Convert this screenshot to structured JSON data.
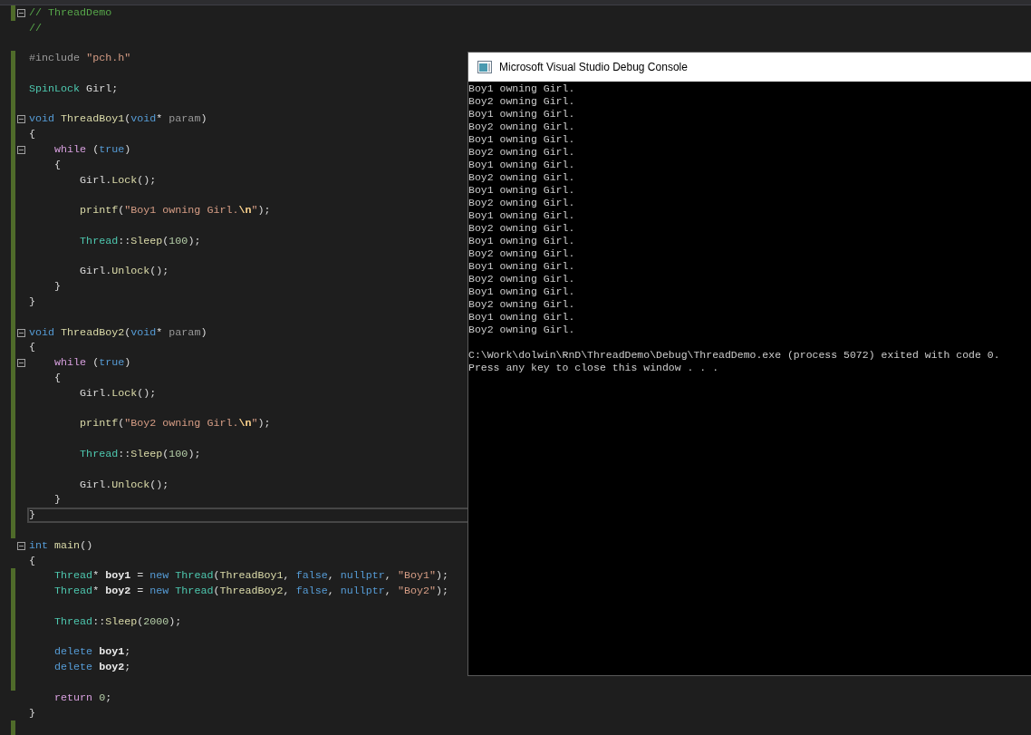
{
  "editor": {
    "lines": [
      {
        "fold": true,
        "changed": true,
        "current": false,
        "tokens": [
          {
            "kind": "comment",
            "text": "// ThreadDemo"
          }
        ]
      },
      {
        "fold": false,
        "changed": false,
        "current": false,
        "tokens": [
          {
            "kind": "comment",
            "text": "//"
          }
        ]
      },
      {
        "fold": false,
        "changed": false,
        "current": false
      },
      {
        "fold": false,
        "changed": true,
        "current": false,
        "tokens": [
          {
            "kind": "preproc",
            "text": "#include "
          },
          {
            "kind": "string",
            "text": "\"pch.h\""
          }
        ]
      },
      {
        "fold": false,
        "changed": true,
        "current": false
      },
      {
        "fold": false,
        "changed": true,
        "current": false,
        "tokens": [
          {
            "kind": "type",
            "text": "SpinLock"
          },
          {
            "kind": "plain",
            "text": " Girl;"
          }
        ]
      },
      {
        "fold": false,
        "changed": true,
        "current": false
      },
      {
        "fold": true,
        "changed": true,
        "current": false,
        "tokens": [
          {
            "kind": "keyword",
            "text": "void "
          },
          {
            "kind": "func",
            "text": "ThreadBoy1"
          },
          {
            "kind": "plain",
            "text": "("
          },
          {
            "kind": "keyword",
            "text": "void"
          },
          {
            "kind": "plain",
            "text": "* "
          },
          {
            "kind": "param",
            "text": "param"
          },
          {
            "kind": "plain",
            "text": ")"
          }
        ]
      },
      {
        "fold": false,
        "changed": true,
        "current": false,
        "tokens": [
          {
            "kind": "plain",
            "text": "{"
          }
        ]
      },
      {
        "fold": true,
        "changed": true,
        "current": false,
        "tokens": [
          {
            "kind": "control",
            "text": "    while"
          },
          {
            "kind": "plain",
            "text": " ("
          },
          {
            "kind": "keyword",
            "text": "true"
          },
          {
            "kind": "plain",
            "text": ")"
          }
        ]
      },
      {
        "fold": false,
        "changed": true,
        "current": false,
        "tokens": [
          {
            "kind": "plain",
            "text": "    {"
          }
        ]
      },
      {
        "fold": false,
        "changed": true,
        "current": false,
        "tokens": [
          {
            "kind": "plain",
            "text": "        Girl."
          },
          {
            "kind": "func",
            "text": "Lock"
          },
          {
            "kind": "plain",
            "text": "();"
          }
        ]
      },
      {
        "fold": false,
        "changed": true,
        "current": false
      },
      {
        "fold": false,
        "changed": true,
        "current": false,
        "tokens": [
          {
            "kind": "func",
            "text": "        printf"
          },
          {
            "kind": "plain",
            "text": "("
          },
          {
            "kind": "string",
            "text": "\"Boy1 owning Girl."
          },
          {
            "kind": "escape",
            "text": "\\n"
          },
          {
            "kind": "string",
            "text": "\""
          },
          {
            "kind": "plain",
            "text": ");"
          }
        ]
      },
      {
        "fold": false,
        "changed": true,
        "current": false
      },
      {
        "fold": false,
        "changed": true,
        "current": false,
        "tokens": [
          {
            "kind": "type",
            "text": "        Thread"
          },
          {
            "kind": "plain",
            "text": "::"
          },
          {
            "kind": "func",
            "text": "Sleep"
          },
          {
            "kind": "plain",
            "text": "("
          },
          {
            "kind": "number",
            "text": "100"
          },
          {
            "kind": "plain",
            "text": ");"
          }
        ]
      },
      {
        "fold": false,
        "changed": true,
        "current": false
      },
      {
        "fold": false,
        "changed": true,
        "current": false,
        "tokens": [
          {
            "kind": "plain",
            "text": "        Girl."
          },
          {
            "kind": "func",
            "text": "Unlock"
          },
          {
            "kind": "plain",
            "text": "();"
          }
        ]
      },
      {
        "fold": false,
        "changed": true,
        "current": false,
        "tokens": [
          {
            "kind": "plain",
            "text": "    }"
          }
        ]
      },
      {
        "fold": false,
        "changed": true,
        "current": false,
        "tokens": [
          {
            "kind": "plain",
            "text": "}"
          }
        ]
      },
      {
        "fold": false,
        "changed": true,
        "current": false
      },
      {
        "fold": true,
        "changed": true,
        "current": false,
        "tokens": [
          {
            "kind": "keyword",
            "text": "void "
          },
          {
            "kind": "func",
            "text": "ThreadBoy2"
          },
          {
            "kind": "plain",
            "text": "("
          },
          {
            "kind": "keyword",
            "text": "void"
          },
          {
            "kind": "plain",
            "text": "* "
          },
          {
            "kind": "param",
            "text": "param"
          },
          {
            "kind": "plain",
            "text": ")"
          }
        ]
      },
      {
        "fold": false,
        "changed": true,
        "current": false,
        "tokens": [
          {
            "kind": "plain",
            "text": "{"
          }
        ]
      },
      {
        "fold": true,
        "changed": true,
        "current": false,
        "tokens": [
          {
            "kind": "control",
            "text": "    while"
          },
          {
            "kind": "plain",
            "text": " ("
          },
          {
            "kind": "keyword",
            "text": "true"
          },
          {
            "kind": "plain",
            "text": ")"
          }
        ]
      },
      {
        "fold": false,
        "changed": true,
        "current": false,
        "tokens": [
          {
            "kind": "plain",
            "text": "    {"
          }
        ]
      },
      {
        "fold": false,
        "changed": true,
        "current": false,
        "tokens": [
          {
            "kind": "plain",
            "text": "        Girl."
          },
          {
            "kind": "func",
            "text": "Lock"
          },
          {
            "kind": "plain",
            "text": "();"
          }
        ]
      },
      {
        "fold": false,
        "changed": true,
        "current": false
      },
      {
        "fold": false,
        "changed": true,
        "current": false,
        "tokens": [
          {
            "kind": "func",
            "text": "        printf"
          },
          {
            "kind": "plain",
            "text": "("
          },
          {
            "kind": "string",
            "text": "\"Boy2 owning Girl."
          },
          {
            "kind": "escape",
            "text": "\\n"
          },
          {
            "kind": "string",
            "text": "\""
          },
          {
            "kind": "plain",
            "text": ");"
          }
        ]
      },
      {
        "fold": false,
        "changed": true,
        "current": false
      },
      {
        "fold": false,
        "changed": true,
        "current": false,
        "tokens": [
          {
            "kind": "type",
            "text": "        Thread"
          },
          {
            "kind": "plain",
            "text": "::"
          },
          {
            "kind": "func",
            "text": "Sleep"
          },
          {
            "kind": "plain",
            "text": "("
          },
          {
            "kind": "number",
            "text": "100"
          },
          {
            "kind": "plain",
            "text": ");"
          }
        ]
      },
      {
        "fold": false,
        "changed": true,
        "current": false
      },
      {
        "fold": false,
        "changed": true,
        "current": false,
        "tokens": [
          {
            "kind": "plain",
            "text": "        Girl."
          },
          {
            "kind": "func",
            "text": "Unlock"
          },
          {
            "kind": "plain",
            "text": "();"
          }
        ]
      },
      {
        "fold": false,
        "changed": true,
        "current": false,
        "tokens": [
          {
            "kind": "plain",
            "text": "    }"
          }
        ]
      },
      {
        "fold": false,
        "changed": true,
        "current": true,
        "tokens": [
          {
            "kind": "plain",
            "text": "}"
          }
        ]
      },
      {
        "fold": false,
        "changed": true,
        "current": false
      },
      {
        "fold": true,
        "changed": false,
        "current": false,
        "tokens": [
          {
            "kind": "keyword",
            "text": "int "
          },
          {
            "kind": "func",
            "text": "main"
          },
          {
            "kind": "plain",
            "text": "()"
          }
        ]
      },
      {
        "fold": false,
        "changed": false,
        "current": false,
        "tokens": [
          {
            "kind": "plain",
            "text": "{"
          }
        ]
      },
      {
        "fold": false,
        "changed": true,
        "current": false,
        "tokens": [
          {
            "kind": "type",
            "text": "    Thread"
          },
          {
            "kind": "plain",
            "text": "* "
          },
          {
            "kind": "local",
            "text": "boy1"
          },
          {
            "kind": "plain",
            "text": " = "
          },
          {
            "kind": "keyword",
            "text": "new "
          },
          {
            "kind": "type",
            "text": "Thread"
          },
          {
            "kind": "plain",
            "text": "("
          },
          {
            "kind": "func",
            "text": "ThreadBoy1"
          },
          {
            "kind": "plain",
            "text": ", "
          },
          {
            "kind": "keyword",
            "text": "false"
          },
          {
            "kind": "plain",
            "text": ", "
          },
          {
            "kind": "keyword",
            "text": "nullptr"
          },
          {
            "kind": "plain",
            "text": ", "
          },
          {
            "kind": "string",
            "text": "\"Boy1\""
          },
          {
            "kind": "plain",
            "text": ");"
          }
        ]
      },
      {
        "fold": false,
        "changed": true,
        "current": false,
        "tokens": [
          {
            "kind": "type",
            "text": "    Thread"
          },
          {
            "kind": "plain",
            "text": "* "
          },
          {
            "kind": "local",
            "text": "boy2"
          },
          {
            "kind": "plain",
            "text": " = "
          },
          {
            "kind": "keyword",
            "text": "new "
          },
          {
            "kind": "type",
            "text": "Thread"
          },
          {
            "kind": "plain",
            "text": "("
          },
          {
            "kind": "func",
            "text": "ThreadBoy2"
          },
          {
            "kind": "plain",
            "text": ", "
          },
          {
            "kind": "keyword",
            "text": "false"
          },
          {
            "kind": "plain",
            "text": ", "
          },
          {
            "kind": "keyword",
            "text": "nullptr"
          },
          {
            "kind": "plain",
            "text": ", "
          },
          {
            "kind": "string",
            "text": "\"Boy2\""
          },
          {
            "kind": "plain",
            "text": ");"
          }
        ]
      },
      {
        "fold": false,
        "changed": true,
        "current": false
      },
      {
        "fold": false,
        "changed": true,
        "current": false,
        "tokens": [
          {
            "kind": "type",
            "text": "    Thread"
          },
          {
            "kind": "plain",
            "text": "::"
          },
          {
            "kind": "func",
            "text": "Sleep"
          },
          {
            "kind": "plain",
            "text": "("
          },
          {
            "kind": "number",
            "text": "2000"
          },
          {
            "kind": "plain",
            "text": ");"
          }
        ]
      },
      {
        "fold": false,
        "changed": true,
        "current": false
      },
      {
        "fold": false,
        "changed": true,
        "current": false,
        "tokens": [
          {
            "kind": "keyword",
            "text": "    delete "
          },
          {
            "kind": "local",
            "text": "boy1"
          },
          {
            "kind": "plain",
            "text": ";"
          }
        ]
      },
      {
        "fold": false,
        "changed": true,
        "current": false,
        "tokens": [
          {
            "kind": "keyword",
            "text": "    delete "
          },
          {
            "kind": "local",
            "text": "boy2"
          },
          {
            "kind": "plain",
            "text": ";"
          }
        ]
      },
      {
        "fold": false,
        "changed": true,
        "current": false
      },
      {
        "fold": false,
        "changed": false,
        "current": false,
        "tokens": [
          {
            "kind": "control",
            "text": "    return "
          },
          {
            "kind": "number",
            "text": "0"
          },
          {
            "kind": "plain",
            "text": ";"
          }
        ]
      },
      {
        "fold": false,
        "changed": false,
        "current": false,
        "tokens": [
          {
            "kind": "plain",
            "text": "}"
          }
        ]
      },
      {
        "fold": false,
        "changed": true,
        "current": false
      }
    ]
  },
  "console": {
    "title": "Microsoft Visual Studio Debug Console",
    "output": [
      "Boy1 owning Girl.",
      "Boy2 owning Girl.",
      "Boy1 owning Girl.",
      "Boy2 owning Girl.",
      "Boy1 owning Girl.",
      "Boy2 owning Girl.",
      "Boy1 owning Girl.",
      "Boy2 owning Girl.",
      "Boy1 owning Girl.",
      "Boy2 owning Girl.",
      "Boy1 owning Girl.",
      "Boy2 owning Girl.",
      "Boy1 owning Girl.",
      "Boy2 owning Girl.",
      "Boy1 owning Girl.",
      "Boy2 owning Girl.",
      "Boy1 owning Girl.",
      "Boy2 owning Girl.",
      "Boy1 owning Girl.",
      "Boy2 owning Girl."
    ],
    "footer": [
      "C:\\Work\\dolwin\\RnD\\ThreadDemo\\Debug\\ThreadDemo.exe (process 5072) exited with code 0.",
      "Press any key to close this window . . ."
    ]
  }
}
